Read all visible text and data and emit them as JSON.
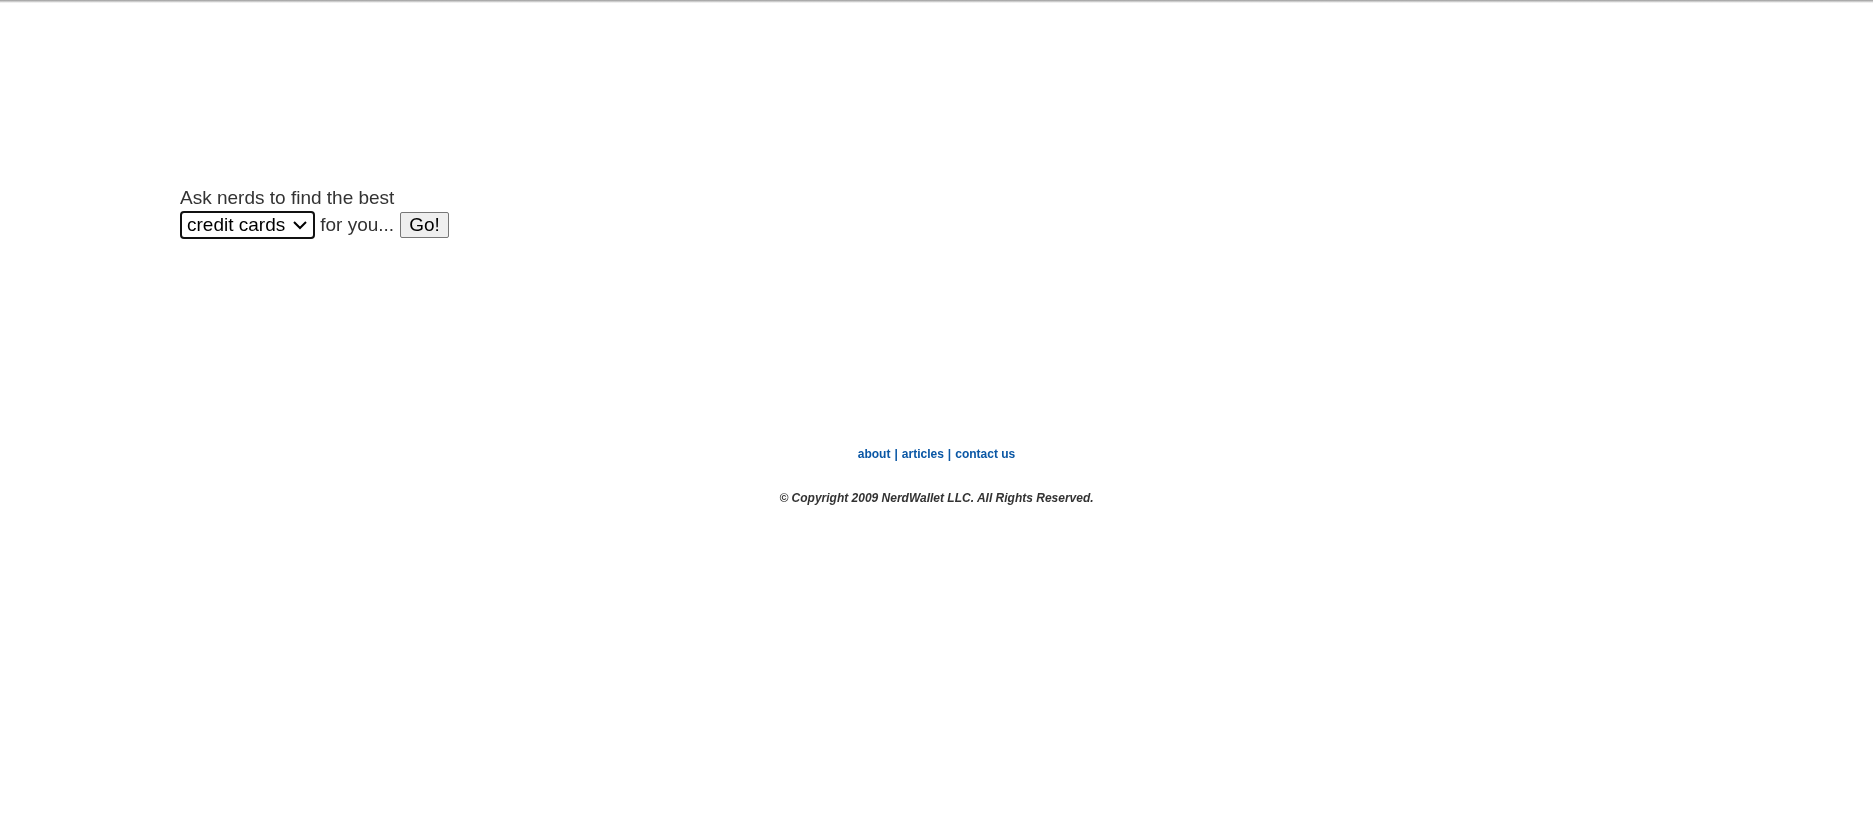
{
  "prompt": {
    "text": "Ask nerds to find the best",
    "select_value": "credit cards",
    "suffix": "for you...",
    "button": "Go!"
  },
  "footer": {
    "links": [
      "about",
      "articles",
      "contact us"
    ],
    "separator": "|",
    "copyright": "© Copyright 2009 NerdWallet LLC. All Rights Reserved."
  }
}
